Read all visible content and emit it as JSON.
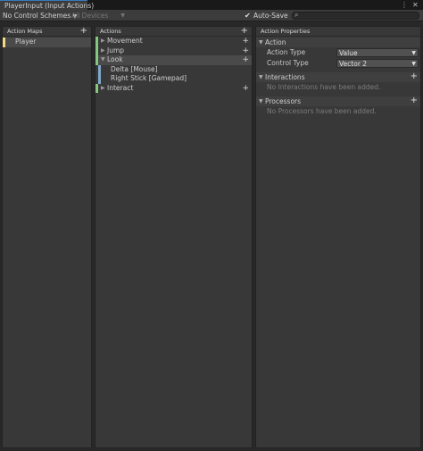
{
  "window": {
    "tab_title": "PlayerInput (Input Actions)",
    "menu_icon": "kebab-icon",
    "close_icon": "close-icon"
  },
  "toolbar": {
    "control_scheme": "No Control Schemes",
    "devices": "All Devices",
    "auto_save_label": "Auto-Save",
    "auto_save_checked": true,
    "search_value": ""
  },
  "action_maps": {
    "header": "Action Maps",
    "items": [
      {
        "label": "Player",
        "color": "#f2d98a",
        "selected": true
      }
    ]
  },
  "actions": {
    "header": "Actions",
    "items": [
      {
        "label": "Movement",
        "expanded": false,
        "color": "#86c77f"
      },
      {
        "label": "Jump",
        "expanded": false,
        "color": "#86c77f"
      },
      {
        "label": "Look",
        "expanded": true,
        "color": "#86c77f",
        "selected": true
      },
      {
        "label": "Delta [Mouse]",
        "binding": true,
        "color": "#7fa8c9"
      },
      {
        "label": "Right Stick [Gamepad]",
        "binding": true,
        "color": "#7fa8c9"
      },
      {
        "label": "Interact",
        "expanded": false,
        "color": "#86c77f"
      }
    ]
  },
  "properties": {
    "header": "Action Properties",
    "action_section": "Action",
    "action_type_label": "Action Type",
    "action_type_value": "Value",
    "control_type_label": "Control Type",
    "control_type_value": "Vector 2",
    "interactions_section": "Interactions",
    "interactions_empty": "No Interactions have been added.",
    "processors_section": "Processors",
    "processors_empty": "No Processors have been added."
  }
}
